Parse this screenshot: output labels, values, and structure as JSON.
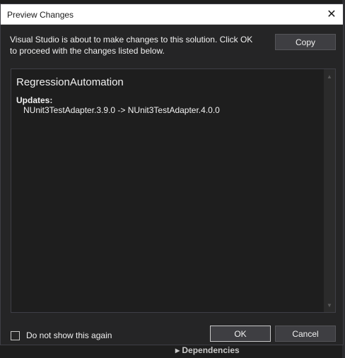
{
  "dialog": {
    "title": "Preview Changes",
    "close_icon": "close-icon",
    "description": "Visual Studio is about to make changes to this solution. Click OK to proceed with the changes listed below.",
    "copy_label": "Copy",
    "ok_label": "OK",
    "cancel_label": "Cancel",
    "checkbox_label": "Do not show this again",
    "checkbox_checked": false
  },
  "changes": {
    "project": "RegressionAutomation",
    "updates_heading": "Updates:",
    "updates": [
      "NUnit3TestAdapter.3.9.0 -> NUnit3TestAdapter.4.0.0"
    ]
  },
  "background": {
    "peek_text": "▸  Dependencies"
  },
  "colors": {
    "dialog_bg": "#252526",
    "panel_bg": "#1e1e1e",
    "text": "#f1f1f1",
    "titlebar_bg": "#ffffff"
  }
}
